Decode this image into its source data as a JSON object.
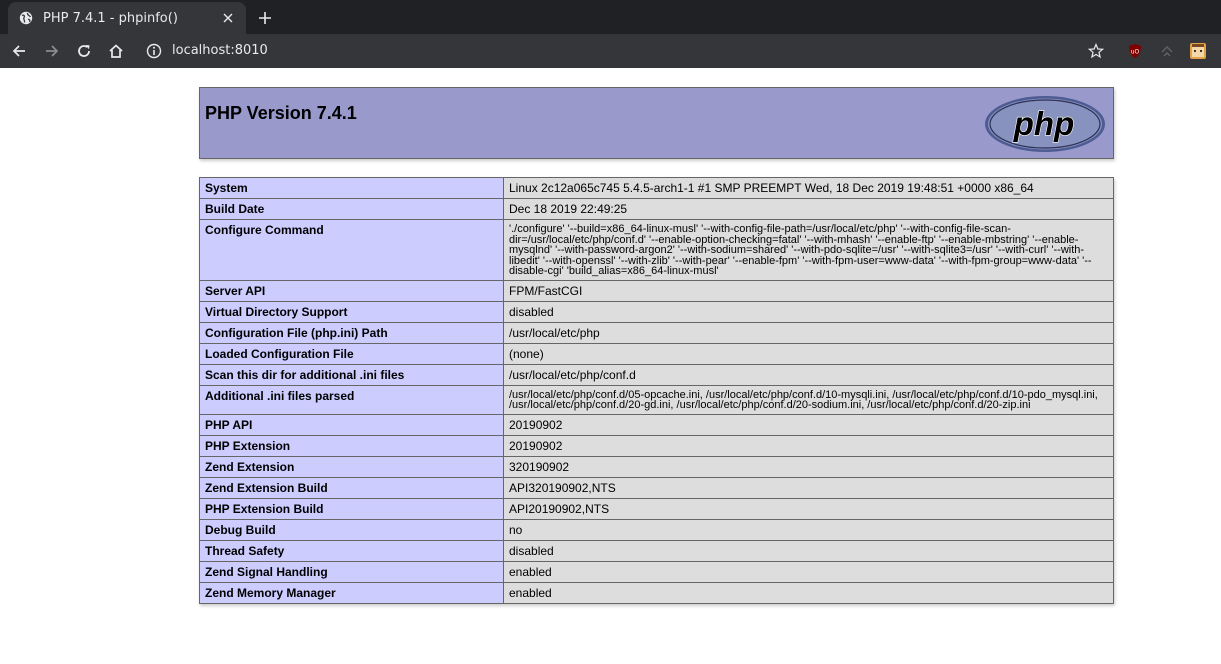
{
  "browser": {
    "tab_title": "PHP 7.4.1 - phpinfo()",
    "url": "localhost:8010",
    "icons": {
      "favicon": "globe-icon",
      "tab_close": "close-icon",
      "new_tab": "plus-icon",
      "back": "arrow-left-icon",
      "forward": "arrow-right-icon",
      "reload": "reload-icon",
      "home": "home-icon",
      "site_info": "info-icon",
      "bookmark": "star-icon",
      "ublock": "ublock-origin-extension-icon",
      "extension2": "extension-icon",
      "profile": "profile-avatar-icon"
    },
    "colors": {
      "tabbar": "#202124",
      "toolbar": "#35363a",
      "text": "#e8eaed"
    }
  },
  "phpinfo": {
    "version_title": "PHP Version 7.4.1",
    "logo_text": "php",
    "colors": {
      "header": "#9999cc",
      "key_cell": "#ccccff",
      "value_cell": "#dddddd"
    },
    "rows": [
      {
        "key": "System",
        "value": "Linux 2c12a065c745 5.4.5-arch1-1 #1 SMP PREEMPT Wed, 18 Dec 2019 19:48:51 +0000 x86_64"
      },
      {
        "key": "Build Date",
        "value": "Dec 18 2019 22:49:25"
      },
      {
        "key": "Configure Command",
        "value": "'./configure' '--build=x86_64-linux-musl' '--with-config-file-path=/usr/local/etc/php' '--with-config-file-scan-dir=/usr/local/etc/php/conf.d' '--enable-option-checking=fatal' '--with-mhash' '--enable-ftp' '--enable-mbstring' '--enable-mysqlnd' '--with-password-argon2' '--with-sodium=shared' '--with-pdo-sqlite=/usr' '--with-sqlite3=/usr' '--with-curl' '--with-libedit' '--with-openssl' '--with-zlib' '--with-pear' '--enable-fpm' '--with-fpm-user=www-data' '--with-fpm-group=www-data' '--disable-cgi' 'build_alias=x86_64-linux-musl'"
      },
      {
        "key": "Server API",
        "value": "FPM/FastCGI"
      },
      {
        "key": "Virtual Directory Support",
        "value": "disabled"
      },
      {
        "key": "Configuration File (php.ini) Path",
        "value": "/usr/local/etc/php"
      },
      {
        "key": "Loaded Configuration File",
        "value": "(none)"
      },
      {
        "key": "Scan this dir for additional .ini files",
        "value": "/usr/local/etc/php/conf.d"
      },
      {
        "key": "Additional .ini files parsed",
        "value": "/usr/local/etc/php/conf.d/05-opcache.ini, /usr/local/etc/php/conf.d/10-mysqli.ini, /usr/local/etc/php/conf.d/10-pdo_mysql.ini, /usr/local/etc/php/conf.d/20-gd.ini, /usr/local/etc/php/conf.d/20-sodium.ini, /usr/local/etc/php/conf.d/20-zip.ini"
      },
      {
        "key": "PHP API",
        "value": "20190902"
      },
      {
        "key": "PHP Extension",
        "value": "20190902"
      },
      {
        "key": "Zend Extension",
        "value": "320190902"
      },
      {
        "key": "Zend Extension Build",
        "value": "API320190902,NTS"
      },
      {
        "key": "PHP Extension Build",
        "value": "API20190902,NTS"
      },
      {
        "key": "Debug Build",
        "value": "no"
      },
      {
        "key": "Thread Safety",
        "value": "disabled"
      },
      {
        "key": "Zend Signal Handling",
        "value": "enabled"
      },
      {
        "key": "Zend Memory Manager",
        "value": "enabled"
      }
    ]
  }
}
